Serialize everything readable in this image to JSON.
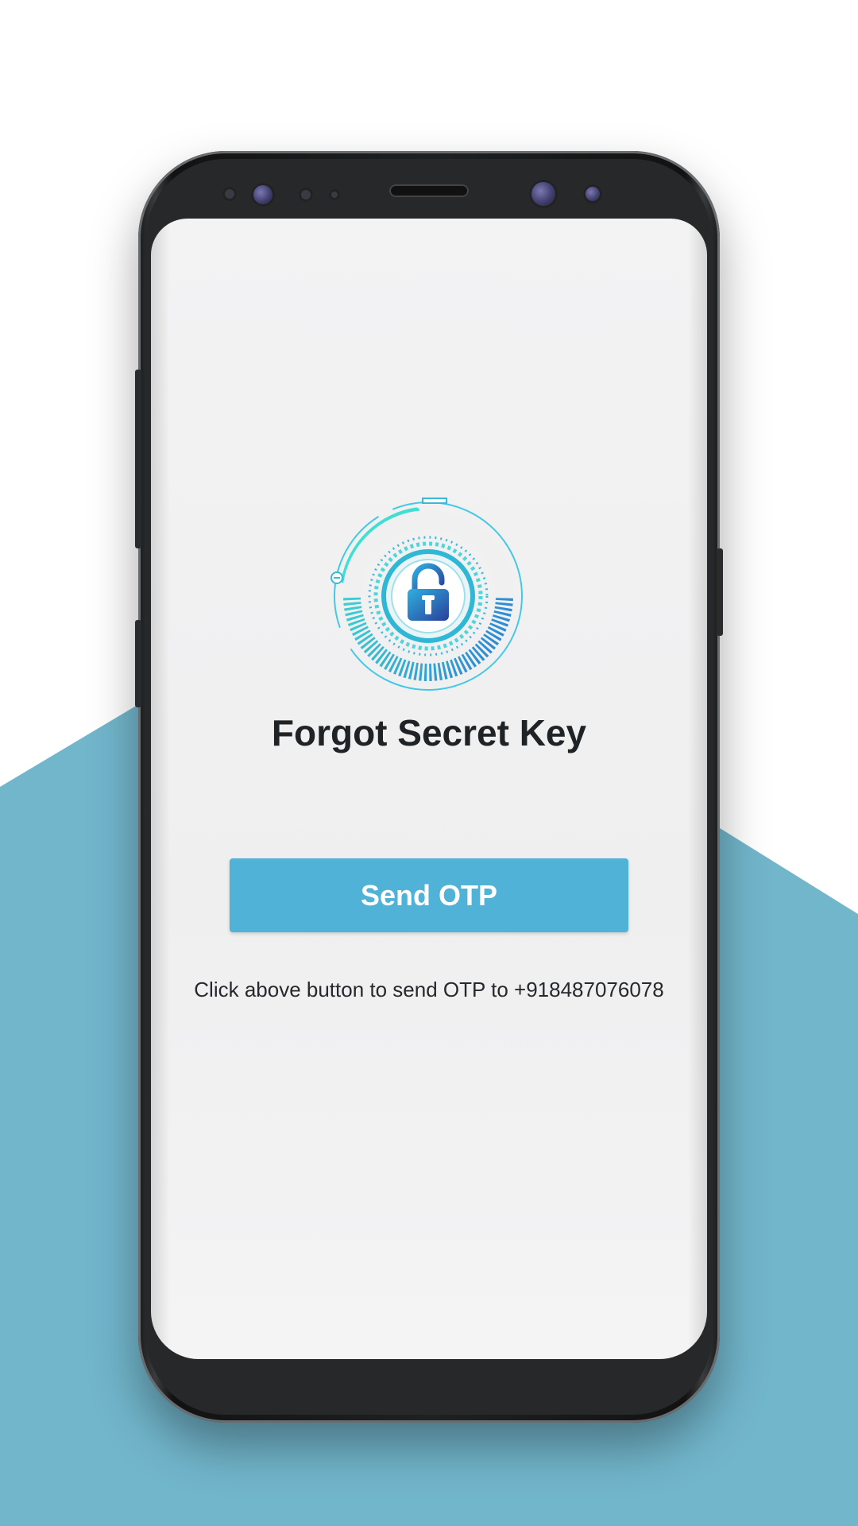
{
  "colors": {
    "background_top": "#ffffff",
    "background_band": "#72b6cc",
    "screen": "#f0f0f1",
    "accent": "#50b2d7",
    "title_text": "#1f2326"
  },
  "screen": {
    "logo_icon": "unlocked-padlock-dial-icon",
    "title": "Forgot Secret Key",
    "send_button_label": "Send OTP",
    "hint_text": "Click above button to send OTP to +918487076078"
  }
}
